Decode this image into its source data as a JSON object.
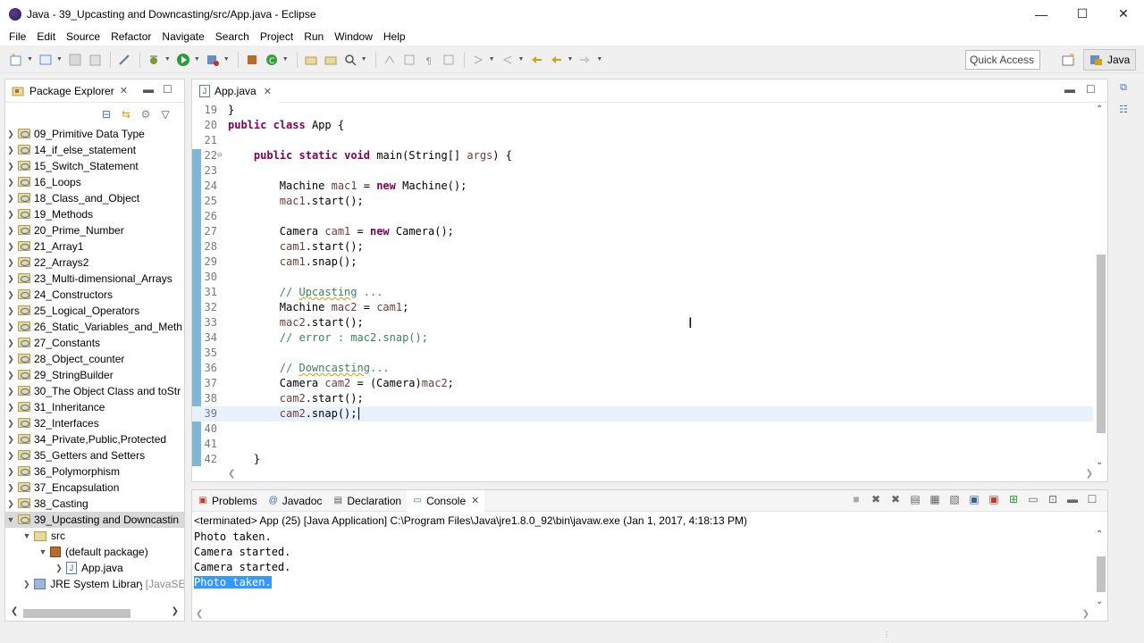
{
  "window": {
    "title": "Java - 39_Upcasting and Downcasting/src/App.java - Eclipse",
    "controls": [
      "—",
      "☐",
      "✕"
    ]
  },
  "menu": [
    "File",
    "Edit",
    "Source",
    "Refactor",
    "Navigate",
    "Search",
    "Project",
    "Run",
    "Window",
    "Help"
  ],
  "toolbar": {
    "quick_access": "Quick Access",
    "perspective": "Java"
  },
  "package_explorer": {
    "title": "Package Explorer",
    "projects": [
      "09_Primitive Data Type",
      "14_if_else_statement",
      "15_Switch_Statement",
      "16_Loops",
      "18_Class_and_Object",
      "19_Methods",
      "20_Prime_Number",
      "21_Array1",
      "22_Arrays2",
      "23_Multi-dimensional_Arrays",
      "24_Constructors",
      "25_Logical_Operators",
      "26_Static_Variables_and_Meth",
      "27_Constants",
      "28_Object_counter",
      "29_StringBuilder",
      "30_The Object Class and toStr",
      "31_Inheritance",
      "32_Interfaces",
      "34_Private,Public,Protected",
      "35_Getters and Setters",
      "36_Polymorphism",
      "37_Encapsulation",
      "38_Casting",
      "39_Upcasting and Downcastin"
    ],
    "expanded": {
      "src": "src",
      "package": "(default package)",
      "file": "App.java",
      "library": "JRE System Library",
      "library_suffix": "[JavaSE"
    }
  },
  "editor": {
    "tab": "App.java",
    "lines": [
      {
        "n": "19",
        "fold": "",
        "html": "}"
      },
      {
        "n": "20",
        "fold": "",
        "html": "<span class='kw'>public</span> <span class='kw'>class</span> App {"
      },
      {
        "n": "21",
        "fold": "",
        "html": ""
      },
      {
        "n": "22",
        "fold": "⊖",
        "html": "    <span class='kw'>public</span> <span class='kw'>static</span> <span class='kw'>void</span> main(String[] <span class='var'>args</span>) {"
      },
      {
        "n": "23",
        "fold": "",
        "html": ""
      },
      {
        "n": "24",
        "fold": "",
        "html": "        Machine <span class='var'>mac1</span> = <span class='kw'>new</span> Machine();"
      },
      {
        "n": "25",
        "fold": "",
        "html": "        <span class='var'>mac1</span>.start();"
      },
      {
        "n": "26",
        "fold": "",
        "html": ""
      },
      {
        "n": "27",
        "fold": "",
        "html": "        Camera <span class='var'>cam1</span> = <span class='kw'>new</span> Camera();"
      },
      {
        "n": "28",
        "fold": "",
        "html": "        <span class='var'>cam1</span>.start();"
      },
      {
        "n": "29",
        "fold": "",
        "html": "        <span class='var'>cam1</span>.snap();"
      },
      {
        "n": "30",
        "fold": "",
        "html": ""
      },
      {
        "n": "31",
        "fold": "",
        "html": "        <span class='cm'>// <span class='ul'>Upcasting</span> ...</span>"
      },
      {
        "n": "32",
        "fold": "",
        "html": "        Machine <span class='var'>mac2</span> = <span class='var'>cam1</span>;"
      },
      {
        "n": "33",
        "fold": "",
        "html": "        <span class='var'>mac2</span>.start();"
      },
      {
        "n": "34",
        "fold": "",
        "html": "        <span class='cm'>// error : mac2.snap();</span>"
      },
      {
        "n": "35",
        "fold": "",
        "html": ""
      },
      {
        "n": "36",
        "fold": "",
        "html": "        <span class='cm'>// <span class='ul'>Downcasting</span>...</span>"
      },
      {
        "n": "37",
        "fold": "",
        "html": "        Camera <span class='var'>cam2</span> = (Camera)<span class='var'>mac2</span>;"
      },
      {
        "n": "38",
        "fold": "",
        "html": "        <span class='var'>cam2</span>.start();"
      },
      {
        "n": "39",
        "fold": "",
        "html": "        <span class='var'>cam2</span>.snap();",
        "current": true
      },
      {
        "n": "40",
        "fold": "",
        "html": ""
      },
      {
        "n": "41",
        "fold": "",
        "html": ""
      },
      {
        "n": "42",
        "fold": "",
        "html": "    }"
      }
    ]
  },
  "console": {
    "tabs": [
      "Problems",
      "Javadoc",
      "Declaration",
      "Console"
    ],
    "active_tab": "Console",
    "status": "<terminated> App (25) [Java Application] C:\\Program Files\\Java\\jre1.8.0_92\\bin\\javaw.exe (Jan 1, 2017, 4:18:13 PM)",
    "output": [
      "Photo taken.",
      "Camera started.",
      "Camera started.",
      "Photo taken."
    ],
    "selected_line_index": 3
  }
}
